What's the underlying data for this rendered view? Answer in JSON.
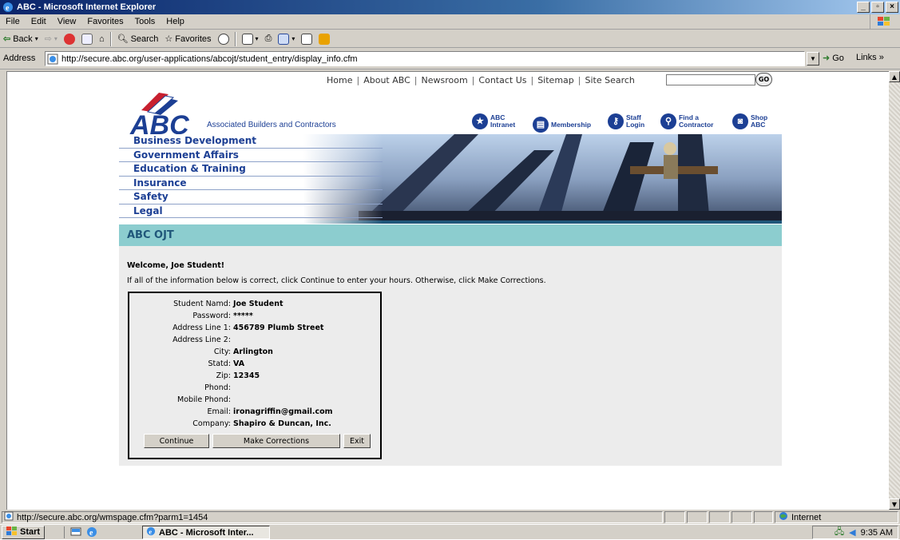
{
  "window": {
    "title": "ABC - Microsoft Internet Explorer"
  },
  "menubar": {
    "items": [
      "File",
      "Edit",
      "View",
      "Favorites",
      "Tools",
      "Help"
    ]
  },
  "toolbar": {
    "back": "Back",
    "search": "Search",
    "favorites": "Favorites"
  },
  "address": {
    "label": "Address",
    "url": "http://secure.abc.org/user-applications/abcojt/student_entry/display_info.cfm",
    "go": "Go",
    "links": "Links"
  },
  "page": {
    "topnav": [
      "Home",
      "About ABC",
      "Newsroom",
      "Contact Us",
      "Sitemap",
      "Site Search"
    ],
    "go_label": "GO",
    "logo_text": "ABC",
    "tagline": "Associated Builders and Contractors",
    "quicklinks": [
      {
        "l1": "ABC",
        "l2": "Intranet"
      },
      {
        "l1": "Membership",
        "l2": ""
      },
      {
        "l1": "Staff",
        "l2": "Login"
      },
      {
        "l1": "Find a",
        "l2": "Contractor"
      },
      {
        "l1": "Shop",
        "l2": "ABC"
      }
    ],
    "menu": [
      "Business Development",
      "Government Affairs",
      "Education & Training",
      "Insurance",
      "Safety",
      "Legal"
    ],
    "section_title": "ABC OJT",
    "welcome": "Welcome, Joe Student!",
    "instructions": "If all of the information below is correct, click Continue to enter your hours. Otherwise, click Make Corrections.",
    "fields": [
      {
        "label": "Student Namd:",
        "value": "Joe Student"
      },
      {
        "label": "Password:",
        "value": "*****"
      },
      {
        "label": "Address Line 1:",
        "value": "456789 Plumb Street"
      },
      {
        "label": "Address Line 2:",
        "value": ""
      },
      {
        "label": "City:",
        "value": "Arlington"
      },
      {
        "label": "Statd:",
        "value": "VA"
      },
      {
        "label": "Zip:",
        "value": "12345"
      },
      {
        "label": "Phond:",
        "value": ""
      },
      {
        "label": "Mobile Phond:",
        "value": ""
      },
      {
        "label": "Email:",
        "value": "ironagriffin@gmail.com"
      },
      {
        "label": "Company:",
        "value": "Shapiro & Duncan, Inc."
      }
    ],
    "buttons": {
      "continue": "Continue",
      "corrections": "Make Corrections",
      "exit": "Exit"
    }
  },
  "status": {
    "text": "http://secure.abc.org/wmspage.cfm?parm1=1454",
    "zone": "Internet"
  },
  "taskbar": {
    "start": "Start",
    "task": "ABC - Microsoft Inter...",
    "clock": "9:35 AM"
  }
}
